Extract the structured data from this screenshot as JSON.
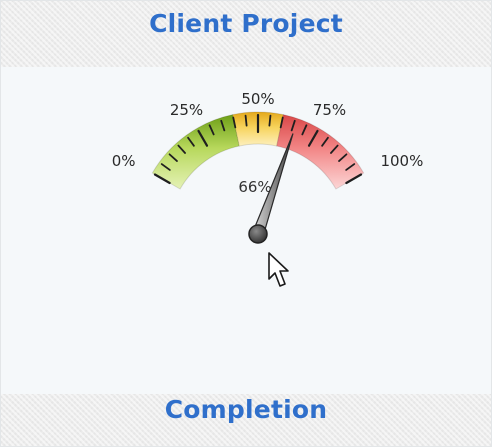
{
  "header": {
    "title": "Client Project"
  },
  "footer": {
    "title": "Completion"
  },
  "gauge": {
    "value": 66,
    "value_label": "66%",
    "min": 0,
    "max": 100,
    "tick_labels": [
      "0%",
      "25%",
      "50%",
      "75%",
      "100%"
    ],
    "bands": [
      {
        "name": "green",
        "from": 0,
        "to": 40,
        "color": "#8fc23a"
      },
      {
        "name": "yellow",
        "from": 40,
        "to": 60,
        "color": "#f2c23a"
      },
      {
        "name": "red",
        "from": 60,
        "to": 100,
        "color": "#ef6666"
      }
    ]
  },
  "cursor": {
    "icon": "mouse-pointer-icon"
  }
}
